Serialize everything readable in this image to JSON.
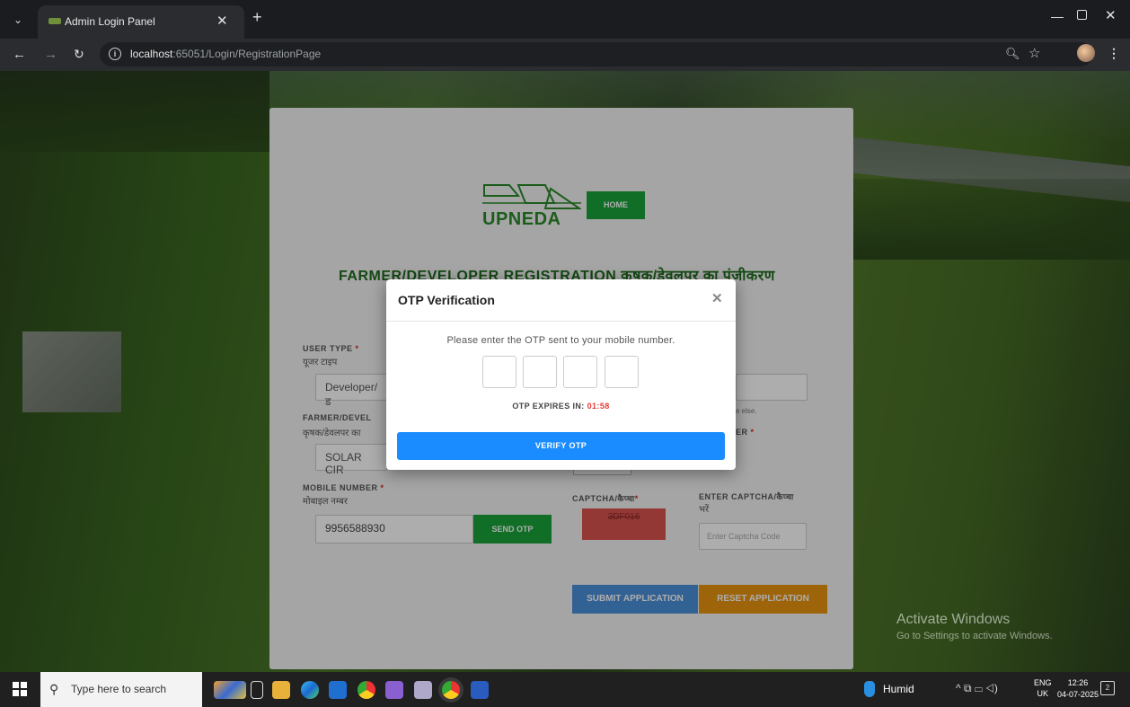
{
  "browser": {
    "tab_title": "Admin Login Panel",
    "url_host": "localhost",
    "url_path": ":65051/Login/RegistrationPage"
  },
  "header": {
    "logo_text": "UPNEDA",
    "home_label": "HOME",
    "title": "FARMER/DEVELOPER REGISTRATION कृषक/डेवलपर का पंजीकरण"
  },
  "form": {
    "user_type_label": "USER TYPE",
    "user_type_hindi": "यूजर टाइप",
    "user_type_value": "Developer/ड",
    "farmer_label": "FARMER/DEVEL",
    "farmer_hindi": "कृषक/डेवलपर का",
    "solar_value": "SOLAR CIR",
    "mobile_label": "MOBILE NUMBER",
    "mobile_hindi": "मोबाइल नम्बर",
    "mobile_value": "9956588930",
    "send_otp_label": "SEND OTP",
    "hint_text": "e else.",
    "er_label": "ER",
    "captcha_label": "CAPTCHA/कैप्चा",
    "enter_captcha_label": "ENTER CAPTCHA/कैप्चा",
    "enter_captcha_hindi": "भरें",
    "captcha_code": "3DF016",
    "captcha_placeholder": "Enter Captcha Code",
    "submit_label": "SUBMIT APPLICATION",
    "reset_label": "RESET APPLICATION",
    "required_mark": "*"
  },
  "modal": {
    "title": "OTP Verification",
    "message": "Please enter the OTP sent to your mobile number.",
    "expires_label": "OTP EXPIRES IN:",
    "expires_time": "01:58",
    "verify_label": "VERIFY OTP"
  },
  "watermark": {
    "line1": "Activate Windows",
    "line2": "Go to Settings to activate Windows."
  },
  "taskbar": {
    "search_placeholder": "Type here to search",
    "weather": "Humid",
    "lang_top": "ENG",
    "lang_bottom": "UK",
    "time": "12:26",
    "date": "04-07-2025",
    "notifications": "2"
  },
  "colors": {
    "accent_green": "#1aa23a",
    "verify_blue": "#1a8cff",
    "submit_blue": "#4a90d9",
    "reset_orange": "#e8940e",
    "timer_red": "#e53935",
    "captcha_red": "#d9534f"
  }
}
